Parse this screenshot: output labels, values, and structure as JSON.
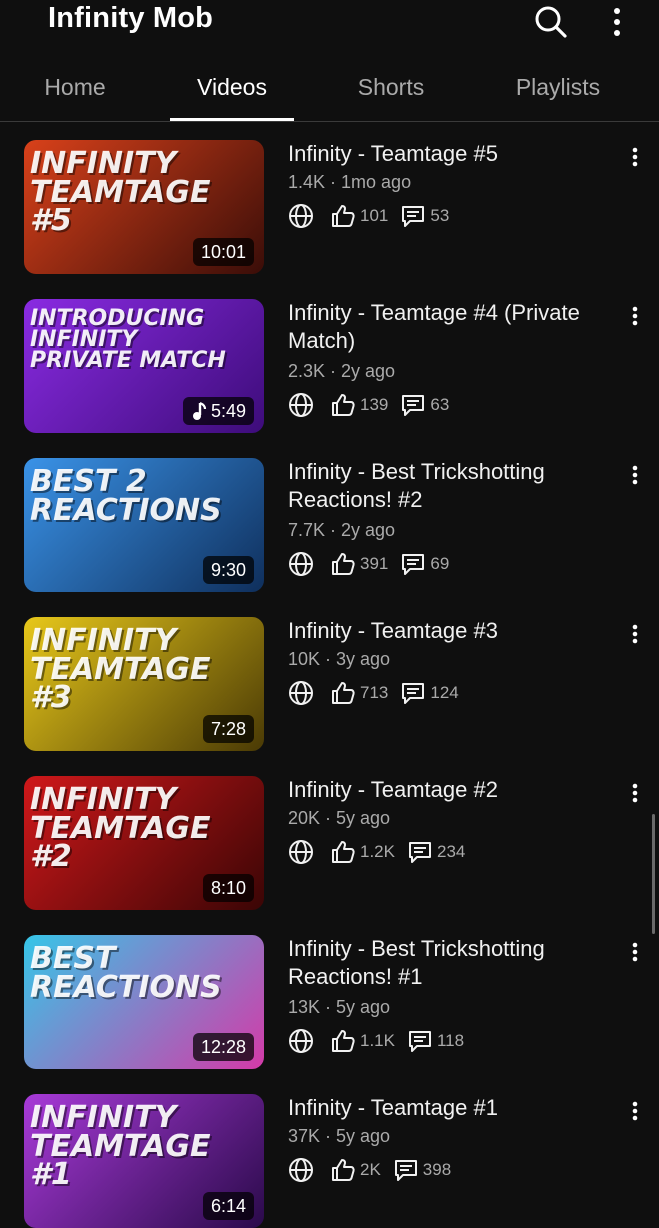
{
  "header": {
    "title": "Infinity Mob",
    "search_icon": "search-icon",
    "more_icon": "more-vert-icon"
  },
  "tabs": [
    {
      "label": "Home",
      "active": false
    },
    {
      "label": "Videos",
      "active": true
    },
    {
      "label": "Shorts",
      "active": false
    },
    {
      "label": "Playlists",
      "active": false
    }
  ],
  "videos": [
    {
      "title": "Infinity - Teamtage #5",
      "meta": "1.4K · 1mo ago",
      "likes": "101",
      "comments": "53",
      "duration": "10:01",
      "thumb_text": "INFINITY TEAMTAGE #5",
      "thumb_colors": [
        "#d9411a",
        "#3a0d08"
      ]
    },
    {
      "title": "Infinity - Teamtage #4 (Private Match)",
      "meta": "2.3K · 2y ago",
      "likes": "139",
      "comments": "63",
      "duration": "5:49",
      "music": true,
      "thumb_text": "INTRODUCING INFINITY PRIVATE MATCH",
      "thumb_colors": [
        "#8a2be2",
        "#3d0c7a"
      ]
    },
    {
      "title": "Infinity - Best Trickshotting Reactions! #2",
      "meta": "7.7K · 2y ago",
      "likes": "391",
      "comments": "69",
      "duration": "9:30",
      "thumb_text": "BEST 2 REACTIONS",
      "thumb_colors": [
        "#3a93e8",
        "#0f2f5c"
      ]
    },
    {
      "title": "Infinity - Teamtage #3",
      "meta": "10K · 3y ago",
      "likes": "713",
      "comments": "124",
      "duration": "7:28",
      "thumb_text": "INFINITY TEAMTAGE #3",
      "thumb_colors": [
        "#e8c81a",
        "#4a3a05"
      ]
    },
    {
      "title": "Infinity - Teamtage #2",
      "meta": "20K · 5y ago",
      "likes": "1.2K",
      "comments": "234",
      "duration": "8:10",
      "thumb_text": "INFINITY TEAMTAGE #2",
      "thumb_colors": [
        "#d0181a",
        "#3a0505"
      ]
    },
    {
      "title": "Infinity - Best Trickshotting Reactions! #1",
      "meta": "13K · 5y ago",
      "likes": "1.1K",
      "comments": "118",
      "duration": "12:28",
      "thumb_text": "BEST REACTIONS",
      "thumb_colors": [
        "#36c6e8",
        "#d43aa8"
      ]
    },
    {
      "title": "Infinity - Teamtage #1",
      "meta": "37K · 5y ago",
      "likes": "2K",
      "comments": "398",
      "duration": "6:14",
      "thumb_text": "INFINITY TEAMTAGE #1",
      "thumb_colors": [
        "#a83ad8",
        "#2a0a4a"
      ]
    }
  ]
}
